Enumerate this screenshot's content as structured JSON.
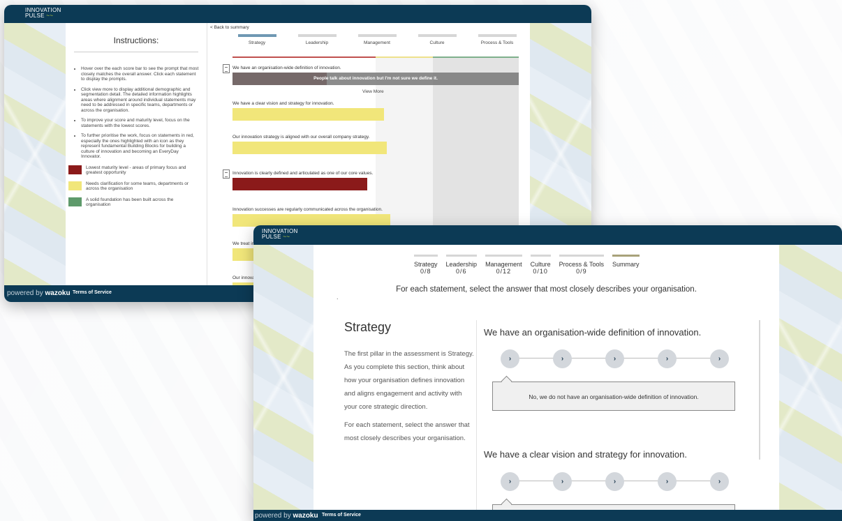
{
  "colors": {
    "red": "#8b1a1a",
    "yellow": "#f1e67a",
    "green": "#5e9a6b",
    "navy": "#0c3a55"
  },
  "brand": {
    "logo_line1": "INNOVATION",
    "logo_line2": "PULSE",
    "logo_wave": "~~",
    "powered_prefix": "powered by",
    "powered_brand": "wazoku",
    "terms": "Terms of Service"
  },
  "window1": {
    "instructions_title": "Instructions:",
    "bullets": [
      "Hover over the each score bar to see the prompt that most closely matches the overall answer. Click each statement to display the prompts.",
      "Click view more to display additional demographic and segmentation detail. The detailed information highlights areas where alignment around individual statements may need to be addressed in specific teams, departments or across the organisation.",
      "To improve your score and maturity level, focus on the statements with the lowest scores.",
      "To further prioritise the work, focus on statements in red, especially the ones highlighted with an icon as they represent fundamental Building Blocks for building a culture of innovation and becoming an EveryDay Innovator."
    ],
    "legend": [
      {
        "text": "Lowest maturity level - areas of primary focus and greatest opportunity",
        "color": "#8b1a1a"
      },
      {
        "text": "Needs clarification for some teams, departments or across the organisation",
        "color": "#f1e67a"
      },
      {
        "text": "A solid foundation has been built across the organisation",
        "color": "#5e9a6b"
      }
    ],
    "back_link": "< Back to summary",
    "tabs": [
      "Strategy",
      "Leadership",
      "Management",
      "Culture",
      "Process & Tools"
    ],
    "statements": [
      {
        "text": "We have an organisation-wide definition of innovation.",
        "color": "#6b1414",
        "score_pct": 33,
        "icon": "document-icon"
      },
      {
        "text": "We have a clear vision and strategy for innovation.",
        "color": "#f1e67a",
        "score_pct": 53,
        "icon": ""
      },
      {
        "text": "Our innovation strategy is aligned with our overall company strategy.",
        "color": "#f1e67a",
        "score_pct": 54,
        "icon": ""
      },
      {
        "text": "Innovation is clearly defined and articulated as one of our core values.",
        "color": "#8b1a1a",
        "score_pct": 47,
        "icon": "document-icon"
      },
      {
        "text": "Innovation successes are regularly communicated across the organisation.",
        "color": "#f1e67a",
        "score_pct": 55,
        "icon": ""
      },
      {
        "text": "We treat in",
        "color": "#f1e67a",
        "score_pct": 60,
        "icon": ""
      },
      {
        "text": "Our innova",
        "color": "#f1e67a",
        "score_pct": 60,
        "icon": ""
      }
    ],
    "tooltip": "People talk about innovation but I'm not sure we define it.",
    "view_more": "View More"
  },
  "window2": {
    "tabs": [
      {
        "label": "Strategy",
        "count": "0/8"
      },
      {
        "label": "Leadership",
        "count": "0/6"
      },
      {
        "label": "Management",
        "count": "0/12"
      },
      {
        "label": "Culture",
        "count": "0/10"
      },
      {
        "label": "Process & Tools",
        "count": "0/9"
      },
      {
        "label": "Summary",
        "count": ""
      }
    ],
    "prompt": "For each statement, select the answer that most closely describes your organisation.",
    "section_title": "Strategy",
    "section_desc1": "The first pillar in the assessment is Strategy. As you complete this section, think about how your organisation defines innovation and aligns engagement and activity with your core strategic direction.",
    "section_desc2": "For each statement, select the answer that most closely describes your organisation.",
    "questions": [
      {
        "text": "We have an organisation-wide definition of innovation.",
        "answer": "No, we do not have an organisation-wide definition of innovation."
      },
      {
        "text": "We have a clear vision and strategy for innovation.",
        "answer": ""
      }
    ],
    "step_glyph": "›"
  }
}
